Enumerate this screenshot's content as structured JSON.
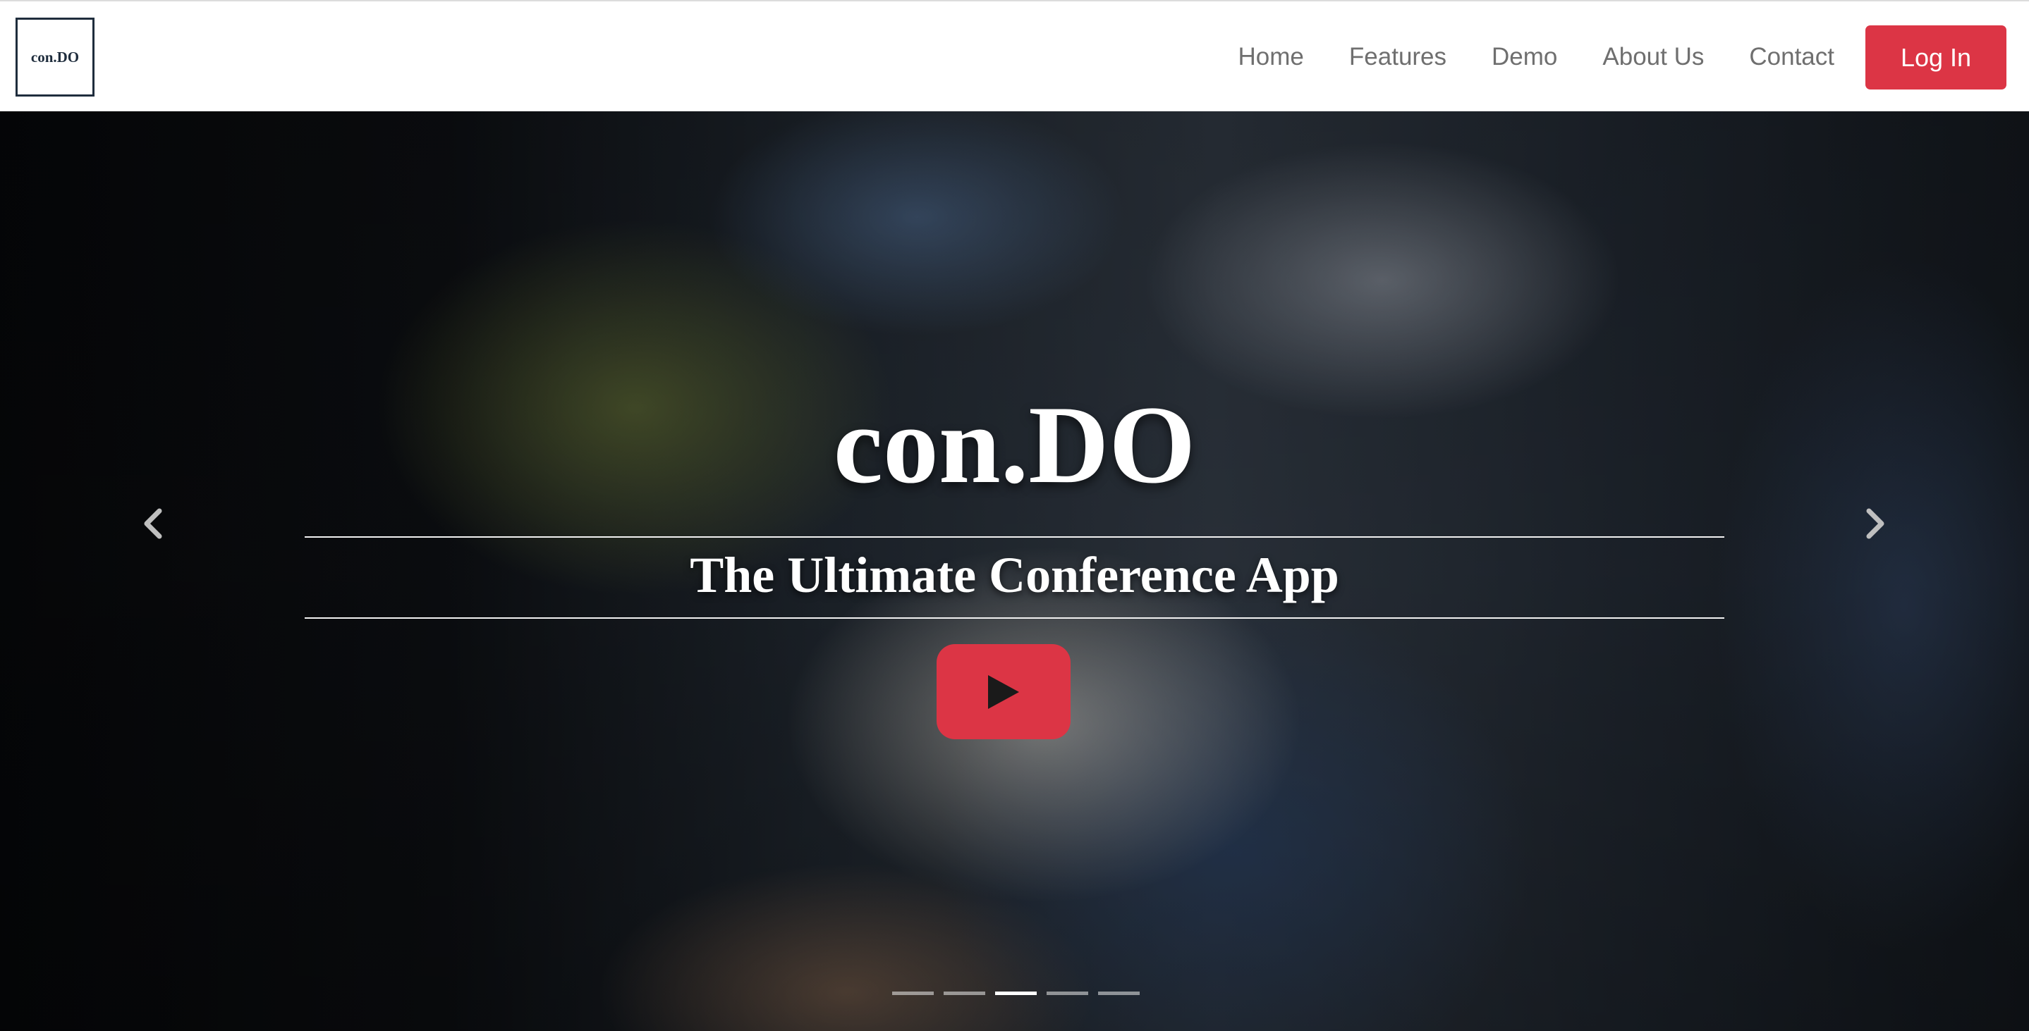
{
  "navbar": {
    "brand": "con.DO",
    "links": [
      {
        "label": "Home"
      },
      {
        "label": "Features"
      },
      {
        "label": "Demo"
      },
      {
        "label": "About Us"
      },
      {
        "label": "Contact"
      }
    ],
    "login_label": "Log In"
  },
  "hero": {
    "title": "con.DO",
    "subtitle": "The Ultimate Conference App",
    "prev_icon": "chevron-left-icon",
    "next_icon": "chevron-right-icon",
    "play_icon": "play-icon",
    "slide_count": 5,
    "active_slide": 3
  },
  "colors": {
    "accent": "#dc3545",
    "brand_border": "#1f2d3d",
    "nav_text": "#6f6f6f"
  }
}
